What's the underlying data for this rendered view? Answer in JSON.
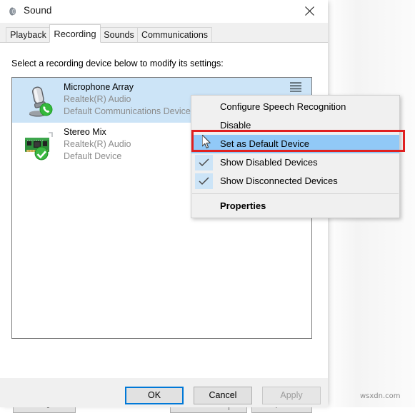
{
  "window": {
    "title": "Sound",
    "icon": "speaker-icon",
    "close_label": "✕"
  },
  "tabs": [
    {
      "label": "Playback",
      "selected": false
    },
    {
      "label": "Recording",
      "selected": true
    },
    {
      "label": "Sounds",
      "selected": false
    },
    {
      "label": "Communications",
      "selected": false
    }
  ],
  "panel": {
    "prompt": "Select a recording device below to modify its settings:"
  },
  "devices": [
    {
      "name": "Microphone Array",
      "driver": "Realtek(R) Audio",
      "status": "Default Communications Device",
      "icon": "microphone-icon",
      "badge": "green-phone-badge",
      "selected": true,
      "meter": "level-meter-icon"
    },
    {
      "name": "Stereo Mix",
      "driver": "Realtek(R) Audio",
      "status": "Default Device",
      "icon": "sound-card-icon",
      "badge": "green-check-badge",
      "selected": false,
      "meter": null
    }
  ],
  "panel_buttons": {
    "configure": "Configure",
    "set_default": "Set Default",
    "set_default_arrow": "dropdown-arrow-icon",
    "properties": "Properties"
  },
  "footer_buttons": {
    "ok": "OK",
    "cancel": "Cancel",
    "apply": "Apply",
    "apply_disabled": true
  },
  "context_menu": {
    "items": [
      {
        "label": "Configure Speech Recognition",
        "checked": false,
        "highlighted": false,
        "bold": false
      },
      {
        "label": "Disable",
        "checked": false,
        "highlighted": false,
        "bold": false
      },
      {
        "label": "Set as Default Device",
        "checked": false,
        "highlighted": true,
        "bold": false
      },
      {
        "label": "Show Disabled Devices",
        "checked": true,
        "highlighted": false,
        "bold": false
      },
      {
        "label": "Show Disconnected Devices",
        "checked": true,
        "highlighted": false,
        "bold": false
      },
      {
        "label": "Properties",
        "checked": false,
        "highlighted": false,
        "bold": true
      }
    ]
  },
  "annotation": {
    "highlight_color": "#e02020",
    "highlight_target": "Set as Default Device"
  },
  "watermark": {
    "text": "wsxdn.com"
  },
  "colors": {
    "selection_blue": "#cce4f7",
    "menu_highlight_blue": "#91c9f7",
    "focus_blue": "#0078d7",
    "green_badge": "#22a728"
  }
}
